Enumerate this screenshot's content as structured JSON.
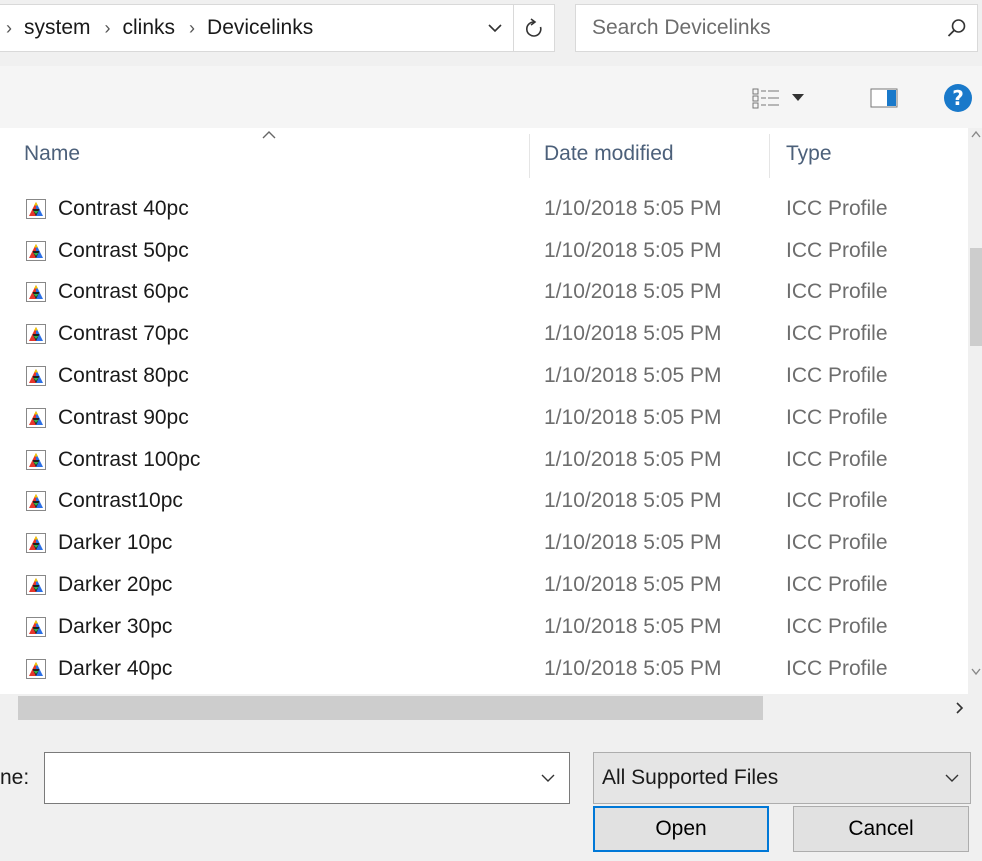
{
  "address": {
    "segments": [
      "system",
      "clinks",
      "Devicelinks"
    ],
    "separator": "›"
  },
  "search": {
    "placeholder": "Search Devicelinks"
  },
  "columns": {
    "name": "Name",
    "date": "Date modified",
    "type": "Type"
  },
  "files": [
    {
      "name": "Contrast 40pc",
      "date": "1/10/2018 5:05 PM",
      "type": "ICC Profile"
    },
    {
      "name": "Contrast 50pc",
      "date": "1/10/2018 5:05 PM",
      "type": "ICC Profile"
    },
    {
      "name": "Contrast 60pc",
      "date": "1/10/2018 5:05 PM",
      "type": "ICC Profile"
    },
    {
      "name": "Contrast 70pc",
      "date": "1/10/2018 5:05 PM",
      "type": "ICC Profile"
    },
    {
      "name": "Contrast 80pc",
      "date": "1/10/2018 5:05 PM",
      "type": "ICC Profile"
    },
    {
      "name": "Contrast 90pc",
      "date": "1/10/2018 5:05 PM",
      "type": "ICC Profile"
    },
    {
      "name": "Contrast 100pc",
      "date": "1/10/2018 5:05 PM",
      "type": "ICC Profile"
    },
    {
      "name": "Contrast10pc",
      "date": "1/10/2018 5:05 PM",
      "type": "ICC Profile"
    },
    {
      "name": "Darker 10pc",
      "date": "1/10/2018 5:05 PM",
      "type": "ICC Profile"
    },
    {
      "name": "Darker 20pc",
      "date": "1/10/2018 5:05 PM",
      "type": "ICC Profile"
    },
    {
      "name": "Darker 30pc",
      "date": "1/10/2018 5:05 PM",
      "type": "ICC Profile"
    },
    {
      "name": "Darker 40pc",
      "date": "1/10/2018 5:05 PM",
      "type": "ICC Profile"
    }
  ],
  "form": {
    "filename_label": "ne:",
    "filename_value": "",
    "filter_selected": "All Supported Files",
    "open_label": "Open",
    "cancel_label": "Cancel"
  },
  "colors": {
    "accent": "#0078d7",
    "help": "#1979ca"
  },
  "icons": {
    "file": "icc-profile-icon",
    "search": "search-icon",
    "refresh": "refresh-icon",
    "view": "view-options-icon",
    "preview": "preview-pane-icon",
    "help": "help-icon"
  }
}
